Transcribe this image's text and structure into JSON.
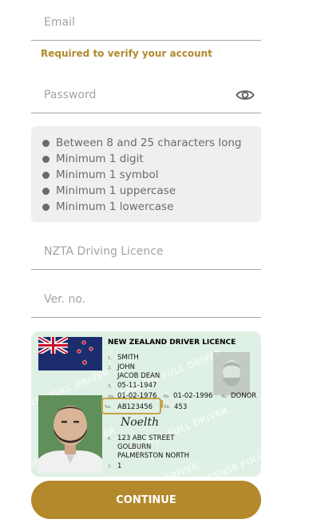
{
  "email": {
    "placeholder": "Email",
    "helper": "Required to verify your account"
  },
  "password": {
    "placeholder": "Password",
    "eye_icon": "eye-icon"
  },
  "rules": [
    "Between 8 and 25 characters long",
    "Minimum 1 digit",
    "Minimum 1 symbol",
    "Minimum 1 uppercase",
    "Minimum 1 lowercase"
  ],
  "licence": {
    "placeholder": "NZTA Driving Licence"
  },
  "version": {
    "placeholder": "Ver. no."
  },
  "card": {
    "title": "NEW ZEALAND DRIVER LICENCE",
    "n1": "1.",
    "surname": "SMITH",
    "n2": "2.",
    "given1": "JOHN",
    "given2": "JACOB DEAN",
    "n3": "3.",
    "dob": "05-11-1947",
    "n4a": "4a.",
    "issue": "01-02-1976",
    "n4b": "4b.",
    "expiry": "01-02-1996",
    "n4c": "4c.",
    "donor": "DONOR",
    "n5a": "5a.",
    "licence_no": "AB123456",
    "n5b": "5b.",
    "version_no": "453",
    "signature": "Noelth",
    "n6": "6.",
    "addr1": "123 ABC STREET",
    "addr2": "GOLBURN",
    "addr3": "PALMERSTON NORTH",
    "n7": "7.",
    "classes": "1",
    "watermark": "LICENSE FULL DRIVER"
  },
  "continue_label": "CONTINUE",
  "colors": {
    "accent": "#b3892b",
    "helper": "#b08a2e",
    "highlight": "#c9a24a"
  }
}
